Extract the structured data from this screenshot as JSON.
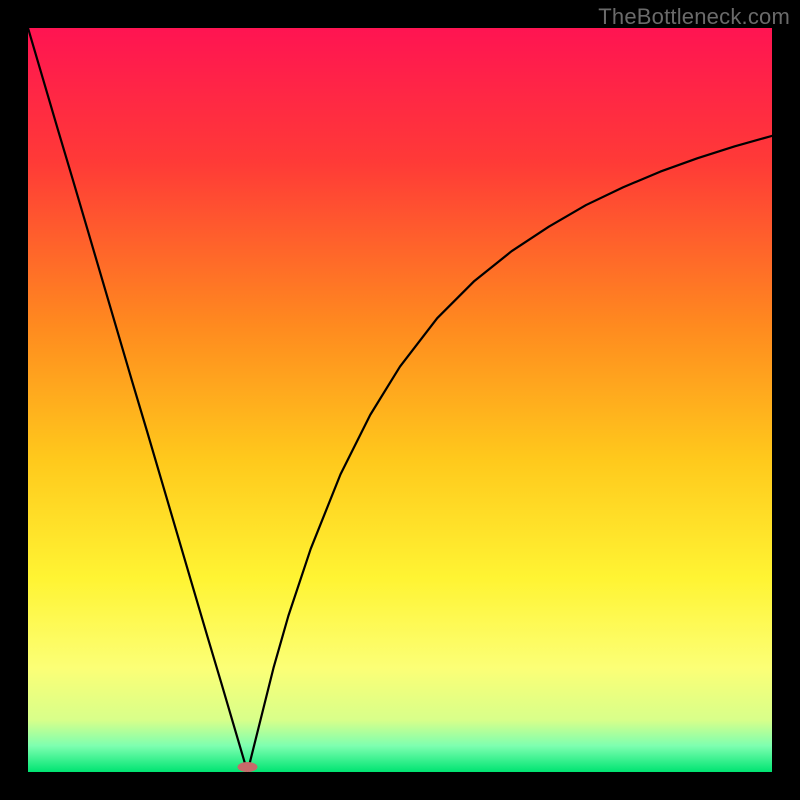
{
  "watermark": "TheBottleneck.com",
  "chart_data": {
    "type": "line",
    "title": "",
    "xlabel": "",
    "ylabel": "",
    "xlim": [
      0,
      100
    ],
    "ylim": [
      0,
      100
    ],
    "grid": false,
    "legend": false,
    "gradient_stops": [
      {
        "offset": 0.0,
        "color": "#ff1452"
      },
      {
        "offset": 0.18,
        "color": "#ff3a37"
      },
      {
        "offset": 0.4,
        "color": "#ff8a1f"
      },
      {
        "offset": 0.58,
        "color": "#ffc91c"
      },
      {
        "offset": 0.74,
        "color": "#fff433"
      },
      {
        "offset": 0.86,
        "color": "#fcff76"
      },
      {
        "offset": 0.93,
        "color": "#d8ff8a"
      },
      {
        "offset": 0.965,
        "color": "#7dffb0"
      },
      {
        "offset": 1.0,
        "color": "#00e472"
      }
    ],
    "series": [
      {
        "name": "left-branch",
        "x": [
          0,
          2,
          4,
          6,
          8,
          10,
          12,
          14,
          16,
          18,
          20,
          22,
          24,
          26,
          28,
          29.5
        ],
        "values": [
          100,
          93.2,
          86.4,
          79.7,
          72.9,
          66.1,
          59.3,
          52.5,
          45.8,
          39.0,
          32.2,
          25.4,
          18.6,
          11.9,
          5.1,
          0
        ]
      },
      {
        "name": "right-branch",
        "x": [
          29.5,
          31,
          33,
          35,
          38,
          42,
          46,
          50,
          55,
          60,
          65,
          70,
          75,
          80,
          85,
          90,
          95,
          100
        ],
        "values": [
          0,
          6,
          14,
          21,
          30,
          40,
          48,
          54.5,
          61,
          66,
          70,
          73.3,
          76.2,
          78.6,
          80.7,
          82.5,
          84.1,
          85.5
        ]
      }
    ],
    "marker": {
      "name": "bottleneck-point",
      "x": 29.5,
      "y": 0,
      "color": "#c76a6a",
      "rx": 10,
      "ry": 5
    }
  }
}
